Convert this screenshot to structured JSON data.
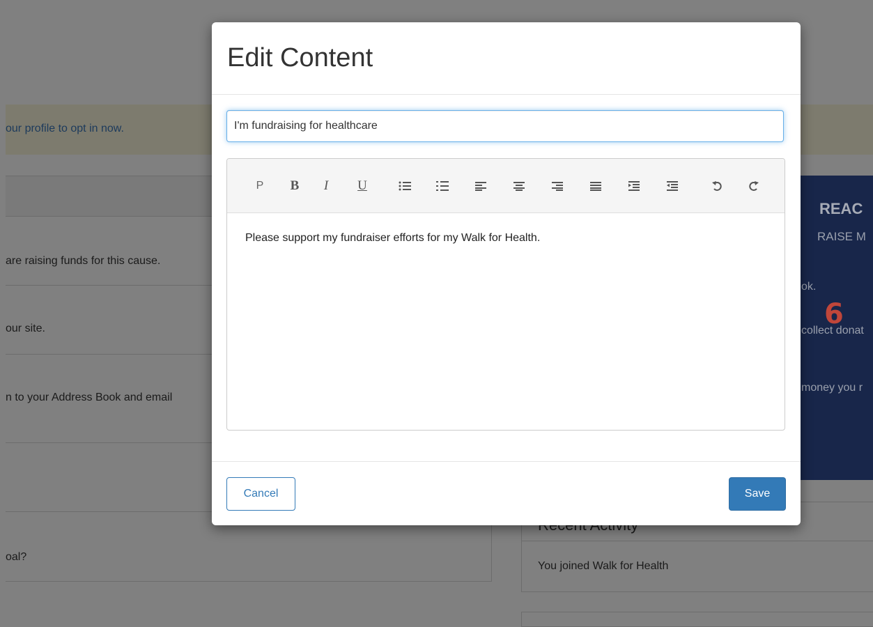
{
  "background": {
    "alert_text": "our profile to opt in now.",
    "left_rows": [
      "are raising funds for this cause.",
      "our site.",
      "n to your Address Book and email"
    ],
    "left_bottom_text": "oal?",
    "promo": {
      "title": "REAC",
      "subtitle": "RAISE M",
      "line1": "ok.",
      "line2": "collect donat",
      "line3": "money you r",
      "number": "6"
    },
    "activity": {
      "title": "Recent Activity",
      "item": "You joined Walk for Health"
    }
  },
  "modal": {
    "title": "Edit Content",
    "title_input_value": "I'm fundraising for healthcare",
    "toolbar": {
      "paragraph": "P",
      "bold": "B",
      "italic": "I",
      "underline": "U"
    },
    "body_text": "Please support my fundraiser efforts for my Walk for Health.",
    "cancel_label": "Cancel",
    "save_label": "Save"
  },
  "colors": {
    "primary": "#337ab7",
    "overlay": "#808080",
    "promo_bg": "#18264a",
    "number_red": "#c0463a"
  }
}
